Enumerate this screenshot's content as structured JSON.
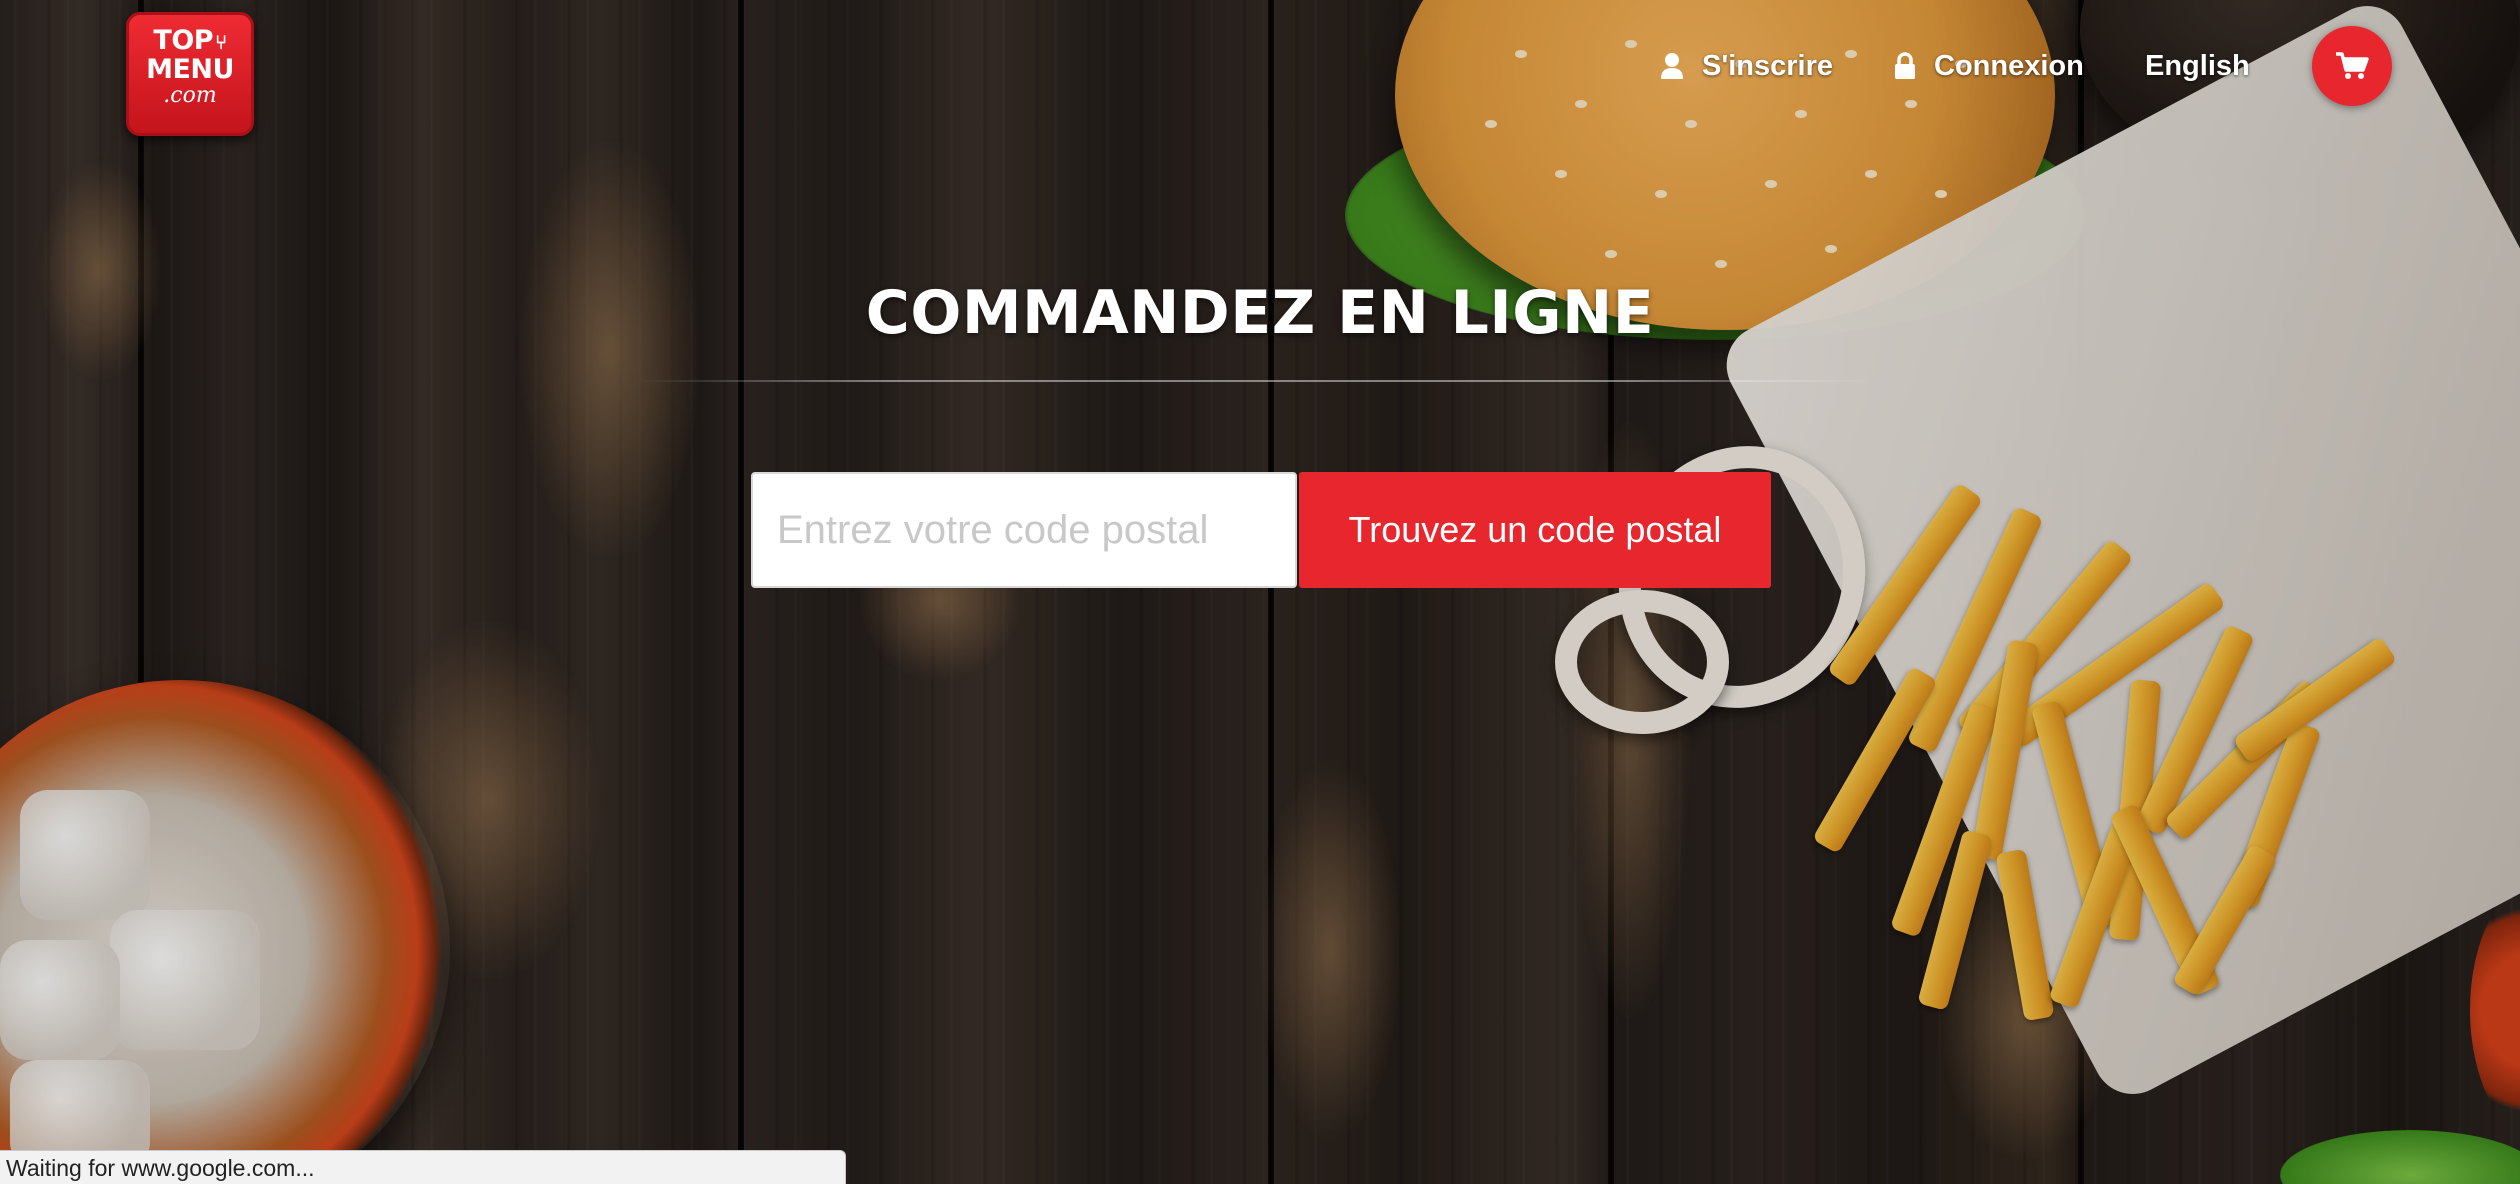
{
  "logo": {
    "line1": "TOP",
    "line2": "MENU",
    "line3": ".com",
    "color": "#e8262e"
  },
  "nav": {
    "signup_label": "S'inscrire",
    "signup_icon": "user-icon",
    "login_label": "Connexion",
    "login_icon": "lock-icon",
    "language_label": "English",
    "cart_icon": "cart-icon"
  },
  "hero": {
    "title": "COMMANDEZ EN LIGNE",
    "search": {
      "placeholder": "Entrez votre code postal",
      "value": ""
    },
    "button_label": "Trouvez un code postal"
  },
  "status_bar": {
    "text": "Waiting for www.google.com..."
  },
  "colors": {
    "accent": "#e8262e",
    "text_on_dark": "#ffffff"
  }
}
